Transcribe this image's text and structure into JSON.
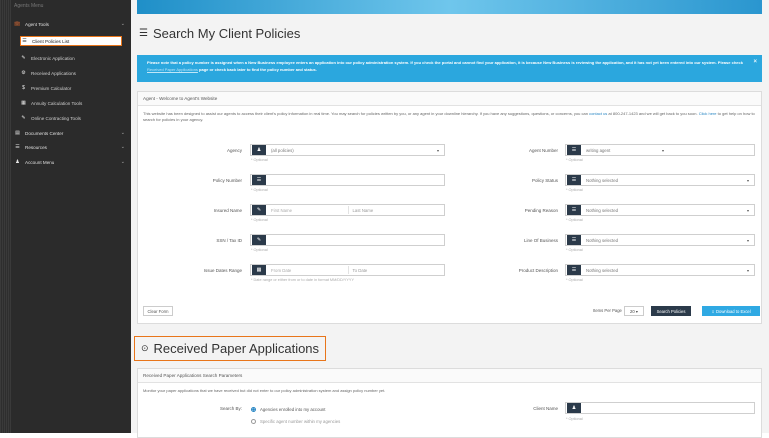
{
  "sidebar": {
    "menu_title": "Agents Menu",
    "items": [
      {
        "label": "Agent Tools",
        "icon": "briefcase-icon",
        "glyph": "💼",
        "chevron": "⌄"
      },
      {
        "label": "Client Policies List",
        "icon": "list-icon",
        "glyph": "☰"
      },
      {
        "label": "Electronic Application",
        "icon": "edit-icon",
        "glyph": "✎"
      },
      {
        "label": "Received Applications",
        "icon": "gear-icon",
        "glyph": "⚙"
      },
      {
        "label": "Premium Calculator",
        "icon": "dollar-icon",
        "glyph": "$"
      },
      {
        "label": "Annuity Calculation Tools",
        "icon": "calculator-icon",
        "glyph": "▦"
      },
      {
        "label": "Online Contracting Tools",
        "icon": "edit-icon",
        "glyph": "✎"
      },
      {
        "label": "Documents Center",
        "icon": "document-icon",
        "glyph": "▤",
        "chevron": "⌄"
      },
      {
        "label": "Resources",
        "icon": "list-icon",
        "glyph": "☰",
        "chevron": "⌄"
      },
      {
        "label": "Account Menu",
        "icon": "user-icon",
        "glyph": "♟",
        "chevron": "⌄"
      }
    ]
  },
  "page": {
    "title": "Search My Client Policies",
    "title_icon": "☰",
    "alert_text": "Please note that a policy number is assigned when a New Business employee enters an application into our policy administration system. If you check the portal and cannot find your application, it is because New Business is reviewing the application, and it has not yet been entered into our system. Please check",
    "alert_link": "Received Paper Applications",
    "alert_tail": "page or check back later to find the policy number and status.",
    "alert_close": "×"
  },
  "welcome": {
    "heading": "Agent - Welcome to Agent's Website",
    "intro_a": "This website has been designed to assist our agents to access their client's policy information in real time. You may search for policies written by you, or any agent in your downline hierarchy. If you have any suggestions, questions, or concerns, you can",
    "intro_link1": "contact us",
    "intro_b": "at 800-247-1423 and we will get back to you soon.",
    "intro_link2": "Click here",
    "intro_c": "to get help on how to search for policies in your agency."
  },
  "form": {
    "optional": "* Optional",
    "agency": {
      "label": "Agency",
      "value": "(all policies)"
    },
    "agent_number": {
      "label": "Agent Number",
      "value": "writing agent"
    },
    "policy_number": {
      "label": "Policy Number"
    },
    "policy_status": {
      "label": "Policy Status",
      "value": "Nothing selected"
    },
    "insured_name": {
      "label": "Insured Name",
      "first": "First Name",
      "last": "Last Name"
    },
    "pending_reason": {
      "label": "Pending Reason",
      "value": "Nothing selected"
    },
    "ssn": {
      "label": "SSN / Tax ID"
    },
    "line_of_business": {
      "label": "Line Of Business",
      "value": "Nothing selected"
    },
    "issue_dates": {
      "label": "Issue Dates Range",
      "from": "From Date",
      "to": "To Date",
      "hint": "* Date range or either from or to date in format MM/DD/YYYY"
    },
    "product_description": {
      "label": "Product Description",
      "value": "Nothing selected"
    }
  },
  "toolbar": {
    "clear": "Clear Form",
    "items_per_page_label": "Items Per Page",
    "items_per_page": "20",
    "search": "Search Policies",
    "download": "Download to Excel"
  },
  "received": {
    "title": "Received Paper Applications",
    "title_icon": "⊙",
    "panel_heading": "Received Paper Applications Search Parameters",
    "description": "Monitor your paper applications that we have received but did not enter to our policy administration system and assign policy number yet.",
    "search_by_label": "Search By:",
    "option1": "Agencies enrolled into my account",
    "option2": "Specific agent number within my agencies",
    "client_name_label": "Client Name",
    "optional": "* Optional"
  },
  "colors": {
    "accent": "#2ba7de",
    "dark_button": "#2b3a4a",
    "highlight": "#e8751a",
    "sidebar": "#2b2b2b"
  }
}
